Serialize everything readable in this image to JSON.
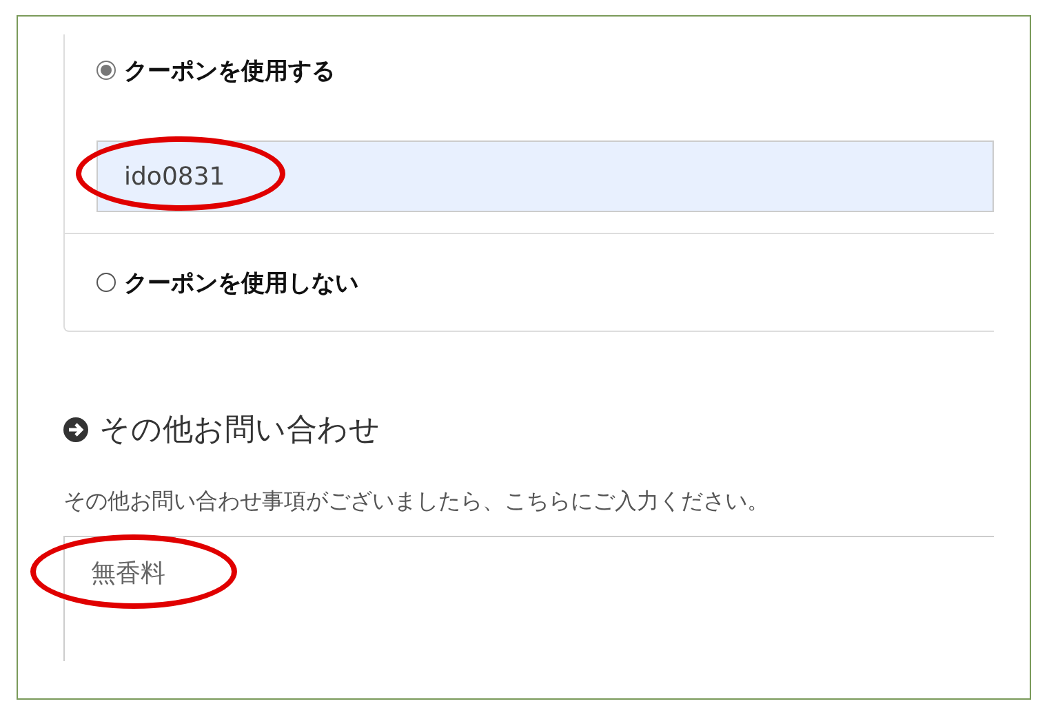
{
  "coupon_options": [
    {
      "kind": "radio",
      "label": "クーポンを使用する",
      "selected": true,
      "field": {
        "value": "ido0831",
        "circled": true
      }
    },
    {
      "kind": "radio",
      "label": "クーポンを使用しない",
      "selected": false
    }
  ],
  "inquiry": {
    "heading": "その他お問い合わせ",
    "description": "その他お問い合わせ事項がございましたら、こちらにご入力ください。",
    "field": {
      "value": "無香料",
      "circled": true
    }
  }
}
